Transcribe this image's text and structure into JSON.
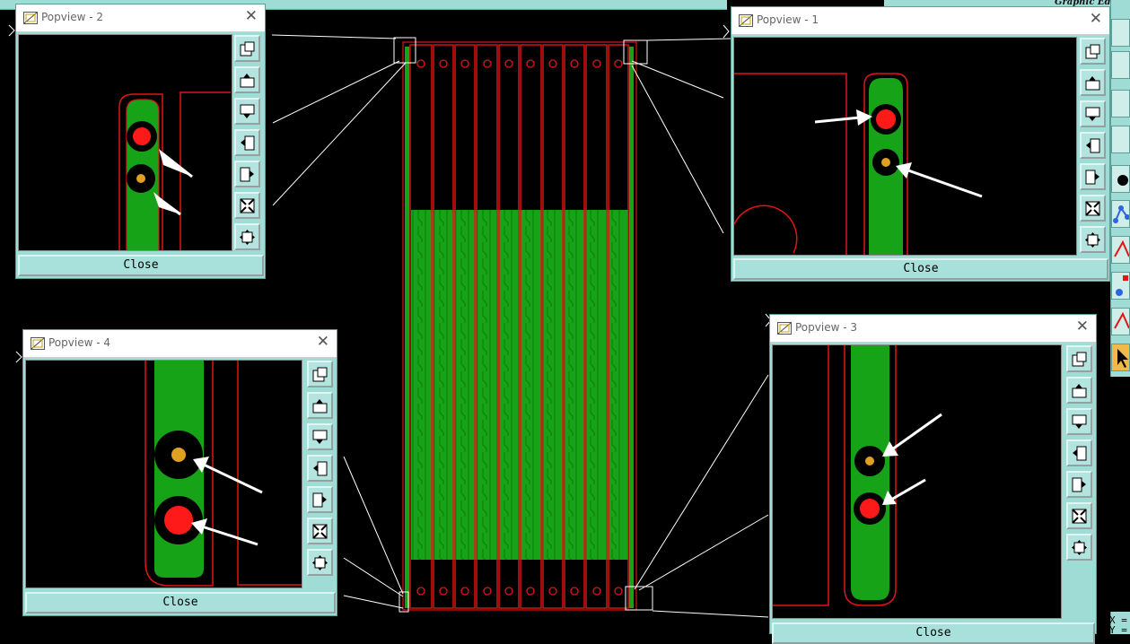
{
  "app": {
    "panel_title": "Graphic Edit",
    "coords_x": "X =",
    "coords_y": "Y ="
  },
  "colors": {
    "copper": "#17a317",
    "outline": "#e01515",
    "via_large": "#ff1a1a",
    "via_small": "#e0a021",
    "window": "#9fdcd6",
    "background": "#000000"
  },
  "popups": [
    {
      "id": "popview-2",
      "title": "Popview - 2",
      "close_label": "Close"
    },
    {
      "id": "popview-1",
      "title": "Popview - 1",
      "close_label": "Close"
    },
    {
      "id": "popview-4",
      "title": "Popview - 4",
      "close_label": "Close"
    },
    {
      "id": "popview-3",
      "title": "Popview - 3",
      "close_label": "Close"
    }
  ],
  "toolbar_icons": [
    "view-fit-icon",
    "zoom-in-icon",
    "zoom-out-icon",
    "pan-left-icon",
    "pan-right-icon",
    "zoom-extents-icon",
    "pan-all-icon"
  ],
  "right_toolbar_icons": [
    "palette-icon-1",
    "palette-icon-2",
    "palette-icon-3",
    "palette-icon-4",
    "palette-icon-5",
    "node-icon",
    "triangle-icon",
    "via-icon",
    "triangle-icon-2",
    "select-pointer-icon"
  ]
}
